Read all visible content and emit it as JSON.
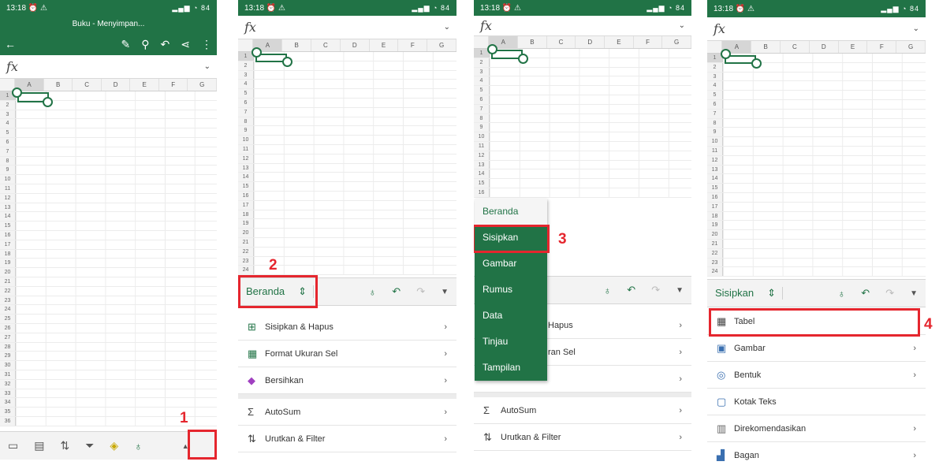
{
  "status": {
    "time": "13:18",
    "icons_left": "⏰ ⚠",
    "icons_right": "▂▄▆ ◔ 84"
  },
  "panel1": {
    "title": "Buku - Menyimpan...",
    "toolbar_icons": [
      "back-arrow-icon",
      "pen-icon",
      "search-icon",
      "undo-icon",
      "share-icon",
      "more-icon"
    ],
    "fx": "fx",
    "columns": [
      "A",
      "B",
      "C",
      "D",
      "E",
      "F",
      "G"
    ],
    "rows": [
      "1",
      "2",
      "3",
      "4",
      "5",
      "6",
      "7",
      "8",
      "9",
      "10",
      "11",
      "12",
      "13",
      "14",
      "15",
      "16",
      "17",
      "18",
      "19",
      "20",
      "21",
      "22",
      "23",
      "24",
      "25",
      "26",
      "27",
      "28",
      "29",
      "30",
      "31",
      "32",
      "33",
      "34",
      "35",
      "36"
    ],
    "bottom_icons": [
      "sheet-icon",
      "table-icon",
      "sort-icon",
      "filter-icon",
      "fill-color-icon",
      "lightbulb-icon",
      "expand-up-icon"
    ],
    "step": "1"
  },
  "panel2": {
    "fx": "fx",
    "columns": [
      "A",
      "B",
      "C",
      "D",
      "E",
      "F",
      "G"
    ],
    "rows": [
      "1",
      "2",
      "3",
      "4",
      "5",
      "6",
      "7",
      "8",
      "9",
      "10",
      "11",
      "12",
      "13",
      "14",
      "15",
      "16",
      "17",
      "18",
      "19",
      "20",
      "21",
      "22",
      "23",
      "24"
    ],
    "ribbon_tab": "Beranda",
    "step": "2",
    "menu": [
      {
        "label": "Sisipkan & Hapus",
        "icon": "insert-delete-icon"
      },
      {
        "label": "Format Ukuran Sel",
        "icon": "cell-size-icon"
      },
      {
        "label": "Bersihkan",
        "icon": "eraser-icon"
      },
      {
        "label": "AutoSum",
        "icon": "sigma-icon"
      },
      {
        "label": "Urutkan & Filter",
        "icon": "sort-filter-icon"
      }
    ]
  },
  "panel3": {
    "fx": "fx",
    "columns": [
      "A",
      "B",
      "C",
      "D",
      "E",
      "F",
      "G"
    ],
    "rows": [
      "1",
      "2",
      "3",
      "4",
      "5",
      "6",
      "7",
      "8",
      "9",
      "10",
      "11",
      "12",
      "13",
      "14",
      "15",
      "16"
    ],
    "dropdown": [
      "Beranda",
      "Sisipkan",
      "Gambar",
      "Rumus",
      "Data",
      "Tinjau",
      "Tampilan"
    ],
    "step": "3",
    "menu_visible": [
      "Hapus",
      "ran Sel",
      "AutoSum",
      "Urutkan & Filter"
    ]
  },
  "panel4": {
    "fx": "fx",
    "columns": [
      "A",
      "B",
      "C",
      "D",
      "E",
      "F",
      "G"
    ],
    "rows": [
      "1",
      "2",
      "3",
      "4",
      "5",
      "6",
      "7",
      "8",
      "9",
      "10",
      "11",
      "12",
      "13",
      "14",
      "15",
      "16",
      "17",
      "18",
      "19",
      "20",
      "21",
      "22",
      "23",
      "24"
    ],
    "ribbon_tab": "Sisipkan",
    "step": "4",
    "menu": [
      {
        "label": "Tabel",
        "icon": "table-icon"
      },
      {
        "label": "Gambar",
        "icon": "image-icon"
      },
      {
        "label": "Bentuk",
        "icon": "shapes-icon"
      },
      {
        "label": "Kotak Teks",
        "icon": "textbox-icon"
      },
      {
        "label": "Direkomendasikan",
        "icon": "recommended-chart-icon"
      },
      {
        "label": "Bagan",
        "icon": "chart-icon"
      }
    ]
  }
}
